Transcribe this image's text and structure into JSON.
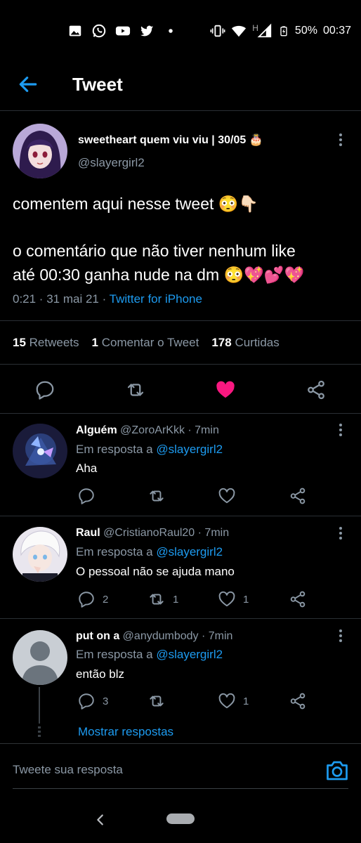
{
  "status_bar": {
    "battery": "50%",
    "time": "00:37",
    "signal_letter": "H",
    "notification_icons": [
      "gallery-icon",
      "whatsapp-icon",
      "youtube-icon",
      "twitter-icon",
      "dot-icon"
    ]
  },
  "header": {
    "title": "Tweet"
  },
  "tweet": {
    "display_name": "sweetheart quem viu viu | 30/05 🎂",
    "handle": "@slayergirl2",
    "text_line1": "comentem aqui nesse tweet 😳👇🏻",
    "text_line2": "o comentário que não tiver nenhum like",
    "text_line3": "até 00:30 ganha nude na dm 😳💖💕💖",
    "meta_time": "0:21 · 31 mai 21 · ",
    "meta_source": "Twitter for iPhone",
    "stats": {
      "retweets_count": "15",
      "retweets_label": "Retweets",
      "quotes_count": "1",
      "quotes_label": "Comentar o Tweet",
      "likes_count": "178",
      "likes_label": "Curtidas"
    },
    "liked": true
  },
  "replies": [
    {
      "name": "Alguém",
      "handle_time": "@ZoroArKkk · 7min",
      "reply_prefix": "Em resposta a ",
      "reply_to": "@slayergirl2",
      "text": "Aha",
      "comments": "",
      "retweets": "",
      "likes": ""
    },
    {
      "name": "Raul",
      "handle_time": "@CristianoRaul20 · 7min",
      "reply_prefix": "Em resposta a ",
      "reply_to": "@slayergirl2",
      "text": "O pessoal não se ajuda mano",
      "comments": "2",
      "retweets": "1",
      "likes": "1"
    },
    {
      "name": "put on a",
      "handle_time": "@anydumbody · 7min",
      "reply_prefix": "Em resposta a ",
      "reply_to": "@slayergirl2",
      "text": "então blz",
      "comments": "3",
      "retweets": "",
      "likes": "1"
    }
  ],
  "show_replies": "Mostrar respostas",
  "compose": {
    "placeholder": "Tweete sua resposta"
  },
  "colors": {
    "accent": "#1d9bf0",
    "like": "#f91880",
    "background": "#000000",
    "muted": "#8b98a5"
  }
}
